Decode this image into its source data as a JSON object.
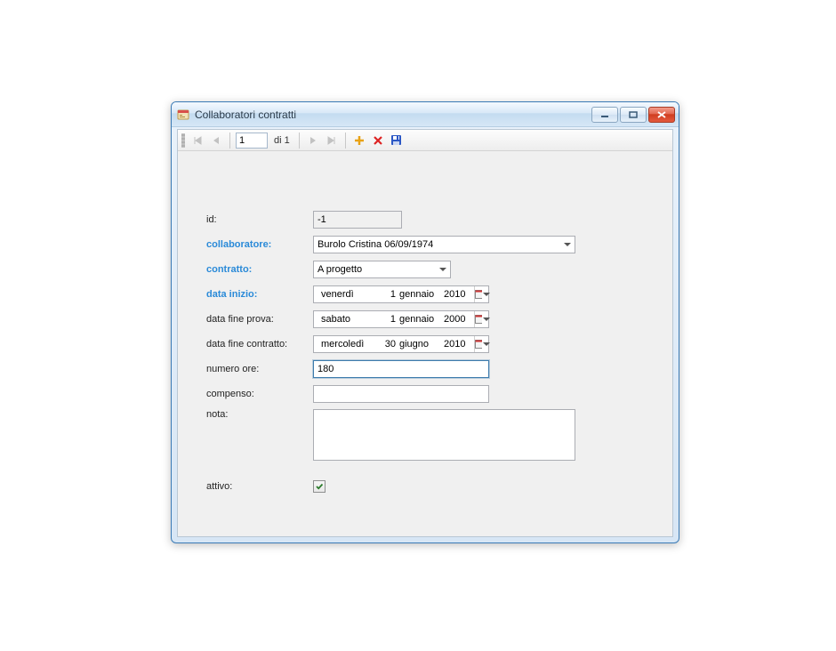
{
  "window": {
    "title": "Collaboratori contratti"
  },
  "nav": {
    "position": "1",
    "total_prefix": "di",
    "total": "1"
  },
  "labels": {
    "id": "id:",
    "collaboratore": "collaboratore:",
    "contratto": "contratto:",
    "data_inizio": "data inizio:",
    "data_fine_prova": "data fine prova:",
    "data_fine_contratto": "data fine contratto:",
    "numero_ore": "numero ore:",
    "compenso": "compenso:",
    "nota": "nota:",
    "attivo": "attivo:"
  },
  "values": {
    "id": "-1",
    "collaboratore": "Burolo Cristina 06/09/1974",
    "contratto": "A progetto",
    "data_inizio": {
      "weekday": "venerdì",
      "dd": "1",
      "month": "gennaio",
      "yyyy": "2010"
    },
    "data_fine_prova": {
      "weekday": "sabato",
      "dd": "1",
      "month": "gennaio",
      "yyyy": "2000"
    },
    "data_fine_contratto": {
      "weekday": "mercoledì",
      "dd": "30",
      "month": "giugno",
      "yyyy": "2010"
    },
    "numero_ore": "180",
    "compenso": "",
    "nota": "",
    "attivo": true
  }
}
